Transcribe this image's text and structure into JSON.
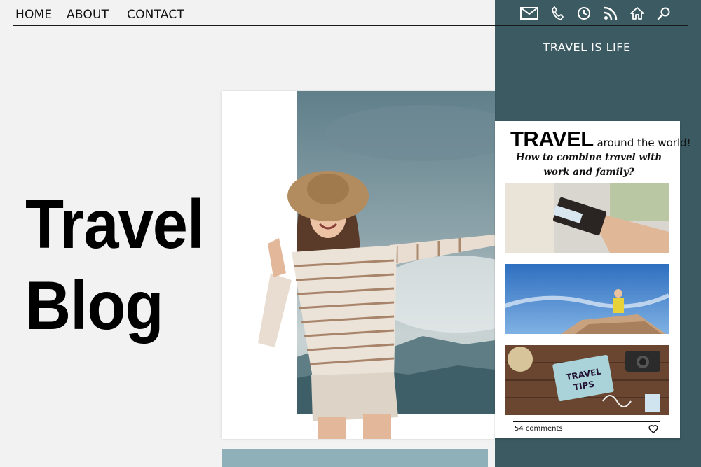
{
  "nav": {
    "links": [
      {
        "label": "HOME"
      },
      {
        "label": "ABOUT"
      },
      {
        "label": "CONTACT"
      }
    ],
    "icons": [
      "mail-icon",
      "phone-icon",
      "clock-icon",
      "rss-icon",
      "home-icon",
      "search-icon"
    ]
  },
  "sidebar": {
    "tagline": "TRAVEL IS LIFE"
  },
  "hero": {
    "title_line1": "Travel",
    "title_line2": "Blog"
  },
  "post": {
    "headline_big": "TRAVEL",
    "headline_small": " around the world!",
    "subtitle_line1": "How to combine travel with",
    "subtitle_line2": "work and family?",
    "comments": "54 comments",
    "thumbnails": [
      "passport-handover-photo",
      "mountain-hiker-photo",
      "travel-tips-flatlay-photo"
    ]
  },
  "colors": {
    "page_bg": "#f2f2f2",
    "sidebar_teal": "#3b5a62",
    "strip_blue": "#8fb0b8",
    "card_white": "#ffffff",
    "text_dark": "#111111"
  }
}
